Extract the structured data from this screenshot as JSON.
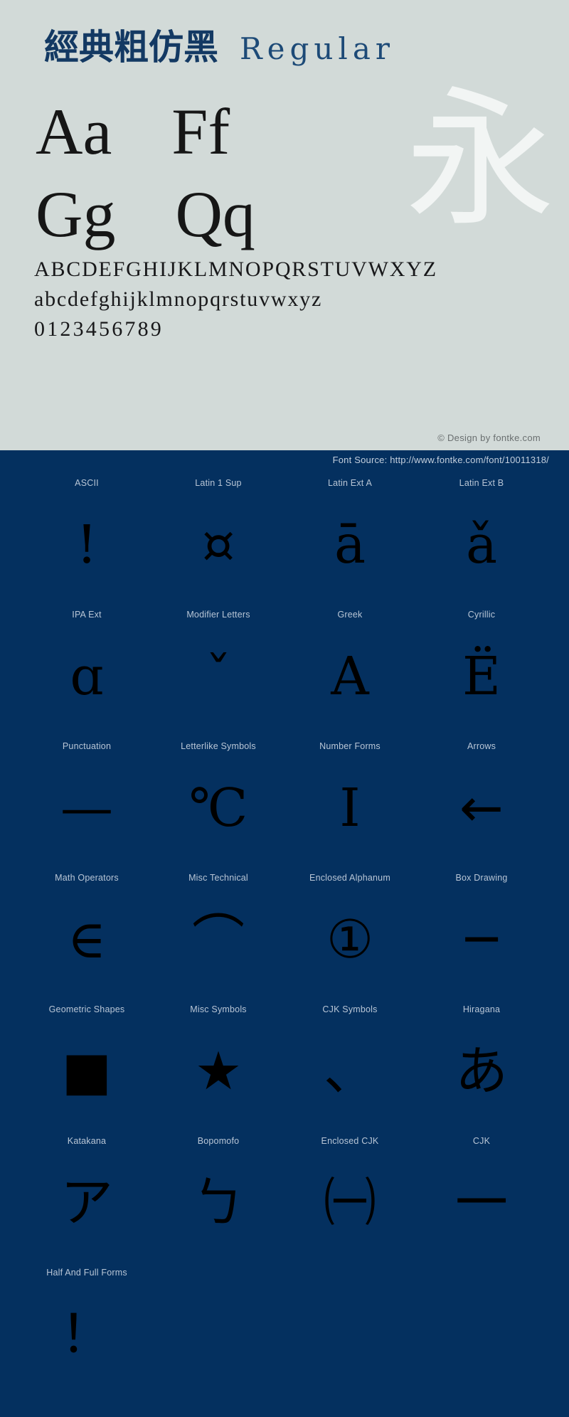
{
  "specimen": {
    "font_name_cjk": "經典粗仿黑",
    "font_style": "Regular",
    "watermark_glyph": "永",
    "sample_pairs": [
      "Aa",
      "Ff",
      "Gg",
      "Qq"
    ],
    "alphabet_uppercase": "ABCDEFGHIJKLMNOPQRSTUVWXYZ",
    "alphabet_lowercase": "abcdefghijklmnopqrstuvwxyz",
    "digits": "0123456789",
    "design_credit": "© Design by fontke.com",
    "background_color": "#d2dad8",
    "title_color": "#133963"
  },
  "blocks_panel": {
    "font_source": "Font Source: http://www.fontke.com/font/10011318/",
    "background_color": "#04305f",
    "label_color": "#b9c6d6",
    "glyph_color": "#000000",
    "rows": [
      [
        {
          "label": "ASCII",
          "glyph": "!"
        },
        {
          "label": "Latin 1 Sup",
          "glyph": "¤"
        },
        {
          "label": "Latin Ext A",
          "glyph": "ā"
        },
        {
          "label": "Latin Ext B",
          "glyph": "ǎ"
        }
      ],
      [
        {
          "label": "IPA Ext",
          "glyph": "ɑ"
        },
        {
          "label": "Modifier Letters",
          "glyph": "ˇ"
        },
        {
          "label": "Greek",
          "glyph": "Α"
        },
        {
          "label": "Cyrillic",
          "glyph": "Ё"
        }
      ],
      [
        {
          "label": "Punctuation",
          "glyph": "—"
        },
        {
          "label": "Letterlike Symbols",
          "glyph": "℃"
        },
        {
          "label": "Number Forms",
          "glyph": "Ⅰ"
        },
        {
          "label": "Arrows",
          "glyph": "←"
        }
      ],
      [
        {
          "label": "Math Operators",
          "glyph": "∈"
        },
        {
          "label": "Misc Technical",
          "glyph": "⌒"
        },
        {
          "label": "Enclosed Alphanum",
          "glyph": "①"
        },
        {
          "label": "Box Drawing",
          "glyph": "─"
        }
      ],
      [
        {
          "label": "Geometric Shapes",
          "glyph": "■"
        },
        {
          "label": "Misc Symbols",
          "glyph": "★"
        },
        {
          "label": "CJK Symbols",
          "glyph": "、"
        },
        {
          "label": "Hiragana",
          "glyph": "あ"
        }
      ],
      [
        {
          "label": "Katakana",
          "glyph": "ア"
        },
        {
          "label": "Bopomofo",
          "glyph": "ㄅ"
        },
        {
          "label": "Enclosed CJK",
          "glyph": "㈠"
        },
        {
          "label": "CJK",
          "glyph": "一"
        }
      ],
      [
        {
          "label": "Half And Full Forms",
          "glyph": "！"
        }
      ]
    ]
  }
}
